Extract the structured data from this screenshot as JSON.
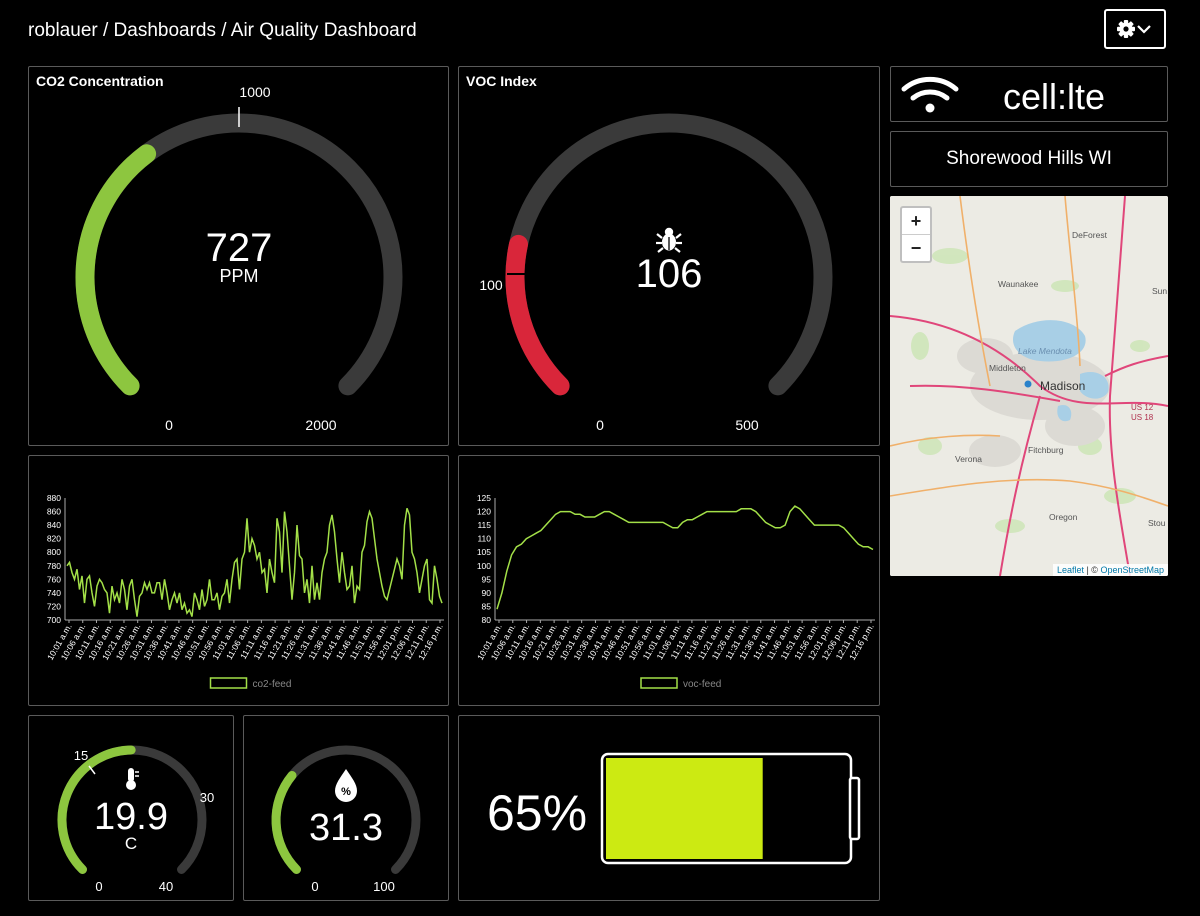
{
  "header": {
    "breadcrumb": "roblauer / Dashboards / Air Quality Dashboard"
  },
  "icons": {
    "settings": "gear-icon",
    "dropdown": "chevron-down-icon",
    "wifi": "wifi-icon",
    "voc": "bug-icon",
    "temperature": "thermometer-icon",
    "humidity": "droplet-percent-icon"
  },
  "colors": {
    "green": "#8dc63f",
    "red": "#d9263a",
    "track": "#3a3a3a",
    "battery": "#ccea12",
    "line": "#a3e048"
  },
  "co2_gauge": {
    "title": "CO2 Concentration",
    "value": "727",
    "unit": "PPM",
    "min": "0",
    "max": "2000",
    "threshold": "1000",
    "fraction": 0.3635
  },
  "voc_gauge": {
    "title": "VOC Index",
    "value": "106",
    "min": "0",
    "max": "500",
    "threshold": "100",
    "fraction": 0.212
  },
  "network": {
    "label": "cell:lte"
  },
  "location": {
    "label": "Shorewood Hills WI"
  },
  "map": {
    "zoom_in": "+",
    "zoom_out": "−",
    "place_labels": [
      "DeForest",
      "Sun",
      "Waunakee",
      "Lake Mendota",
      "Middleton",
      "Madison",
      "US 12",
      "US 18",
      "Verona",
      "Fitchburg",
      "Oregon",
      "Stou"
    ],
    "attribution": {
      "leaflet": "Leaflet",
      "separator": " | © ",
      "osm": "OpenStreetMap"
    }
  },
  "temp_gauge": {
    "value": "19.9",
    "unit": "C",
    "min": "0",
    "max": "40",
    "label_15": "15",
    "label_30": "30",
    "fraction": 0.4975
  },
  "humidity_gauge": {
    "value": "31.3",
    "min": "0",
    "max": "100",
    "fraction": 0.313
  },
  "battery": {
    "percent_label": "65%",
    "level": 0.65
  },
  "chart_data": [
    {
      "type": "line",
      "series": [
        {
          "name": "co2-feed",
          "values": [
            780,
            785,
            770,
            760,
            775,
            745,
            765,
            725,
            760,
            765,
            740,
            720,
            750,
            760,
            755,
            745,
            740,
            710,
            750,
            730,
            740,
            725,
            760,
            745,
            715,
            750,
            760,
            730,
            705,
            735,
            740,
            755,
            745,
            755,
            740,
            740,
            755,
            755,
            730,
            760,
            740,
            715,
            730,
            740,
            725,
            740,
            715,
            725,
            710,
            715,
            705,
            740,
            730,
            715,
            745,
            720,
            730,
            760,
            730,
            730,
            740,
            715,
            735,
            740,
            760,
            725,
            760,
            785,
            790,
            745,
            790,
            800,
            850,
            800,
            820,
            810,
            790,
            800,
            770,
            775,
            740,
            790,
            770,
            755,
            850,
            830,
            770,
            860,
            830,
            780,
            730,
            770,
            840,
            795,
            790,
            740,
            760,
            725,
            780,
            730,
            755,
            730,
            770,
            790,
            800,
            840,
            855,
            830,
            790,
            755,
            800,
            770,
            745,
            750,
            780,
            725,
            750,
            745,
            800,
            810,
            845,
            860,
            850,
            820,
            790,
            770,
            750,
            735,
            730,
            745,
            760,
            775,
            790,
            780,
            760,
            840,
            865,
            855,
            800,
            790,
            770,
            740,
            760,
            780,
            790,
            730,
            725,
            780,
            760,
            735,
            725
          ]
        }
      ],
      "ylim": [
        700,
        880
      ],
      "yticks": [
        "700",
        "720",
        "740",
        "760",
        "780",
        "800",
        "820",
        "840",
        "860",
        "880"
      ],
      "xticks": [
        "10:01 a.m.",
        "10:06 a.m.",
        "10:11 a.m.",
        "10:16 a.m.",
        "10:21 a.m.",
        "10:26 a.m.",
        "10:31 a.m.",
        "10:36 a.m.",
        "10:41 a.m.",
        "10:46 a.m.",
        "10:51 a.m.",
        "10:56 a.m.",
        "11:01 a.m.",
        "11:06 a.m.",
        "11:11 a.m.",
        "11:16 a.m.",
        "11:21 a.m.",
        "11:26 a.m.",
        "11:31 a.m.",
        "11:36 a.m.",
        "11:41 a.m.",
        "11:46 a.m.",
        "11:51 a.m.",
        "11:56 a.m.",
        "12:01 p.m.",
        "12:06 p.m.",
        "12:11 p.m.",
        "12:16 p.m."
      ]
    },
    {
      "type": "line",
      "series": [
        {
          "name": "voc-feed",
          "values": [
            84,
            90,
            98,
            104,
            107,
            108,
            110,
            111,
            112,
            113,
            115,
            117,
            119,
            120,
            120,
            120,
            119,
            119,
            118,
            118,
            118,
            119,
            120,
            120,
            119,
            118,
            117,
            116,
            116,
            116,
            116,
            116,
            116,
            116,
            116,
            115,
            114,
            114,
            116,
            117,
            117,
            118,
            119,
            120,
            120,
            120,
            120,
            120,
            120,
            120,
            121,
            121,
            121,
            120,
            118,
            116,
            115,
            114,
            114,
            115,
            120,
            122,
            121,
            119,
            117,
            115,
            115,
            115,
            115,
            115,
            115,
            114,
            112,
            110,
            108,
            107,
            107,
            106
          ]
        }
      ],
      "ylim": [
        80,
        125
      ],
      "yticks": [
        "80",
        "85",
        "90",
        "95",
        "100",
        "105",
        "110",
        "115",
        "120",
        "125"
      ],
      "xticks": [
        "10:01 a.m.",
        "10:06 a.m.",
        "10:11 a.m.",
        "10:16 a.m.",
        "10:21 a.m.",
        "10:26 a.m.",
        "10:31 a.m.",
        "10:36 a.m.",
        "10:41 a.m.",
        "10:46 a.m.",
        "10:51 a.m.",
        "10:56 a.m.",
        "11:01 a.m.",
        "11:06 a.m.",
        "11:11 a.m.",
        "11:16 a.m.",
        "11:21 a.m.",
        "11:26 a.m.",
        "11:31 a.m.",
        "11:36 a.m.",
        "11:41 a.m.",
        "11:46 a.m.",
        "11:51 a.m.",
        "11:56 a.m.",
        "12:01 p.m.",
        "12:06 p.m.",
        "12:11 p.m.",
        "12:16 p.m."
      ]
    }
  ]
}
